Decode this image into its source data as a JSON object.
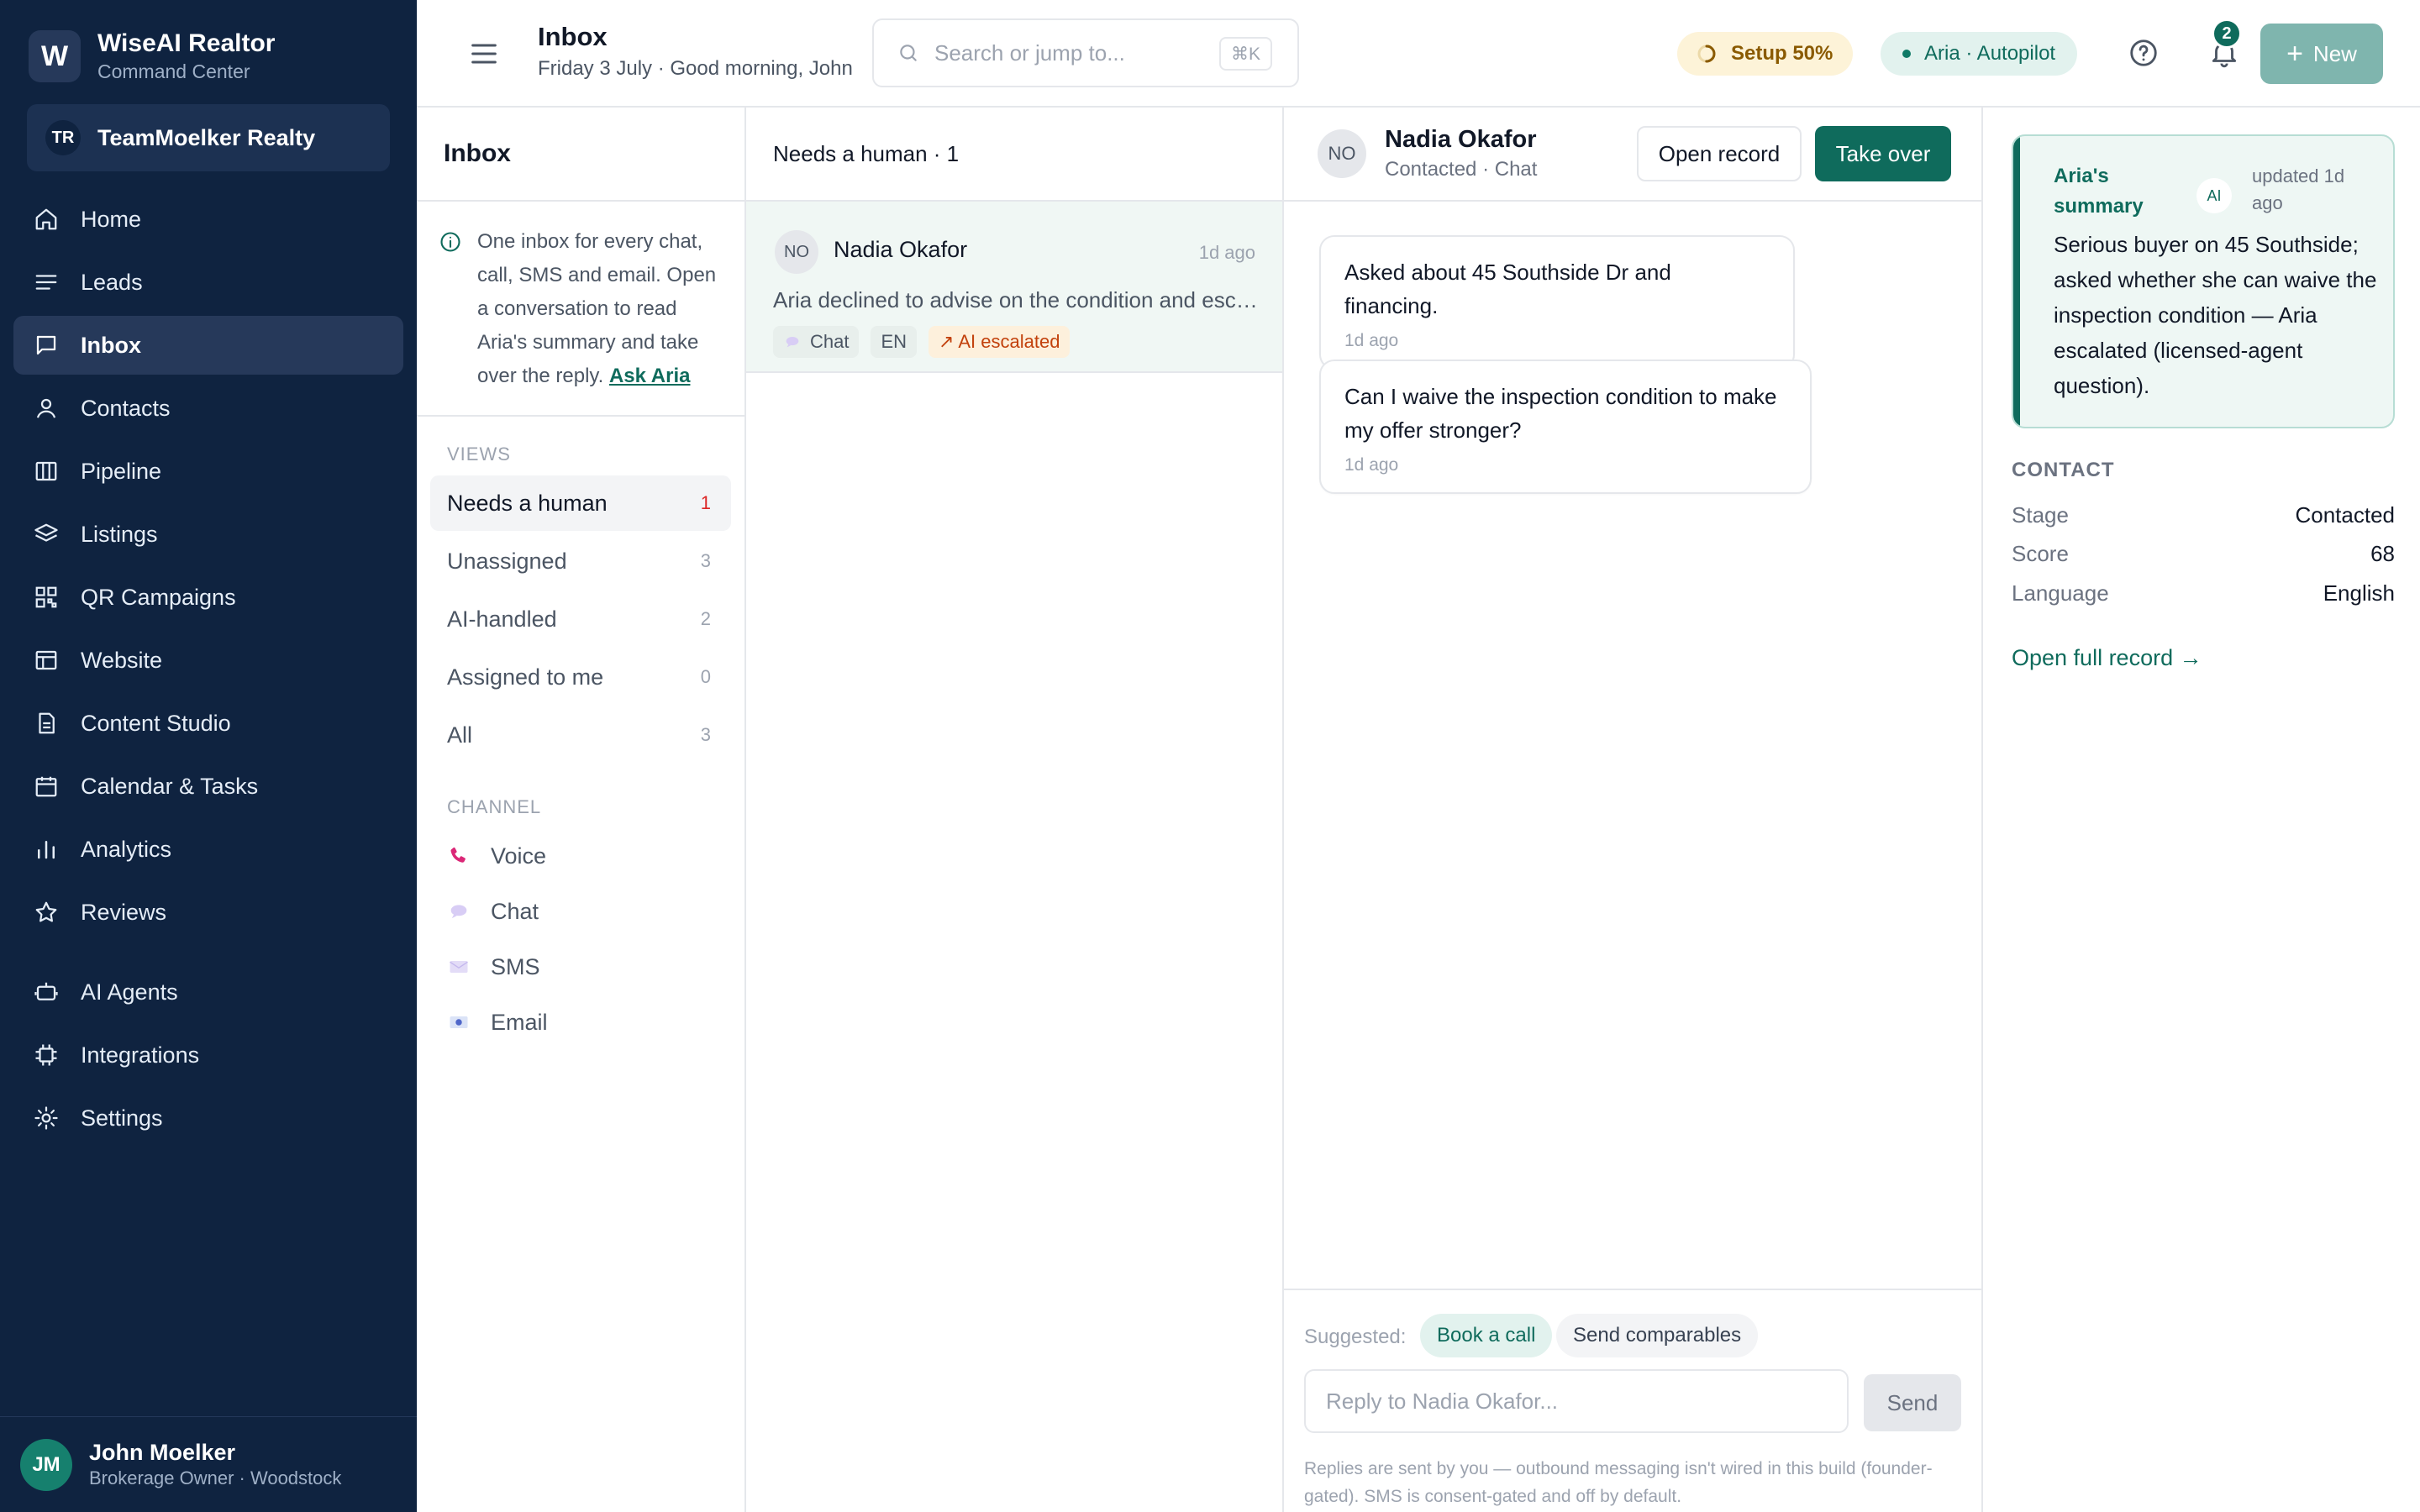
{
  "brand": {
    "logo_letter": "W",
    "name": "WiseAI Realtor",
    "subtitle": "Command Center"
  },
  "workspace": {
    "initials": "TR",
    "name": "TeamMoelker Realty"
  },
  "nav": {
    "items": [
      {
        "label": "Home",
        "icon": "home-icon"
      },
      {
        "label": "Leads",
        "icon": "list-icon"
      },
      {
        "label": "Inbox",
        "icon": "message-icon",
        "active": true
      },
      {
        "label": "Contacts",
        "icon": "user-icon"
      },
      {
        "label": "Pipeline",
        "icon": "columns-icon"
      },
      {
        "label": "Listings",
        "icon": "layers-icon"
      },
      {
        "label": "QR Campaigns",
        "icon": "qr-icon"
      },
      {
        "label": "Website",
        "icon": "layout-icon"
      },
      {
        "label": "Content Studio",
        "icon": "document-icon"
      },
      {
        "label": "Calendar & Tasks",
        "icon": "calendar-icon"
      },
      {
        "label": "Analytics",
        "icon": "bar-chart-icon"
      },
      {
        "label": "Reviews",
        "icon": "star-icon"
      }
    ],
    "secondary": [
      {
        "label": "AI Agents",
        "icon": "robot-icon"
      },
      {
        "label": "Integrations",
        "icon": "chip-icon"
      },
      {
        "label": "Settings",
        "icon": "gear-icon"
      }
    ]
  },
  "user": {
    "initials": "JM",
    "name": "John Moelker",
    "role": "Brokerage Owner · Woodstock"
  },
  "topbar": {
    "title": "Inbox",
    "subtitle": "Friday 3 July · Good morning, John",
    "search_placeholder": "Search or jump to...",
    "search_shortcut": "⌘K",
    "setup_label": "Setup 50%",
    "setup_progress": 0.5,
    "aria_label": "Aria · Autopilot",
    "notifications_count": "2",
    "new_label": "New"
  },
  "filters": {
    "title": "Inbox",
    "info_text": "One inbox for every chat, call, SMS and email. Open a conversation to read Aria's summary and take over the reply.",
    "info_link": "Ask Aria",
    "views_label": "VIEWS",
    "views": [
      {
        "label": "Needs a human",
        "count": "1",
        "active": true
      },
      {
        "label": "Unassigned",
        "count": "3"
      },
      {
        "label": "AI-handled",
        "count": "2"
      },
      {
        "label": "Assigned to me",
        "count": "0"
      },
      {
        "label": "All",
        "count": "3"
      }
    ],
    "channel_label": "CHANNEL",
    "channels": [
      {
        "label": "Voice",
        "icon": "phone-icon"
      },
      {
        "label": "Chat",
        "icon": "chat-bubble-icon"
      },
      {
        "label": "SMS",
        "icon": "sms-icon"
      },
      {
        "label": "Email",
        "icon": "email-icon"
      }
    ]
  },
  "list": {
    "header": "Needs a human · 1",
    "conversations": [
      {
        "initials": "NO",
        "name": "Nadia Okafor",
        "time": "1d ago",
        "preview": "Aria declined to advise on the condition and escalated to a licensed agent.",
        "tags": [
          "Chat",
          "EN",
          "↗ AI escalated"
        ]
      }
    ]
  },
  "thread": {
    "initials": "NO",
    "name": "Nadia Okafor",
    "status": "Contacted · Chat",
    "open_record_label": "Open record",
    "take_over_label": "Take over",
    "messages": [
      {
        "text": "Asked about 45 Southside Dr and financing.",
        "time": "1d ago"
      },
      {
        "text": "Can I waive the inspection condition to make my offer stronger?",
        "time": "1d ago"
      }
    ],
    "suggested_label": "Suggested:",
    "suggestions": [
      "Book a call",
      "Send comparables"
    ],
    "reply_placeholder": "Reply to Nadia Okafor...",
    "send_label": "Send",
    "footnote": "Replies are sent by you — outbound messaging isn't wired in this build (founder-gated). SMS is consent-gated and off by default."
  },
  "details": {
    "summary_title": "Aria's summary",
    "ai_badge": "AI",
    "summary_updated": "updated 1d ago",
    "summary_text": "Serious buyer on 45 Southside; asked whether she can waive the inspection condition — Aria escalated (licensed-agent question).",
    "contact_label": "CONTACT",
    "fields": [
      {
        "key": "Stage",
        "value": "Contacted"
      },
      {
        "key": "Score",
        "value": "68"
      },
      {
        "key": "Language",
        "value": "English"
      }
    ],
    "full_record_label": "Open full record →"
  },
  "colors": {
    "sidebar_bg": "#0f2340",
    "accent": "#0f6b5c",
    "alert": "#dc2626",
    "warn": "#c2410c"
  }
}
